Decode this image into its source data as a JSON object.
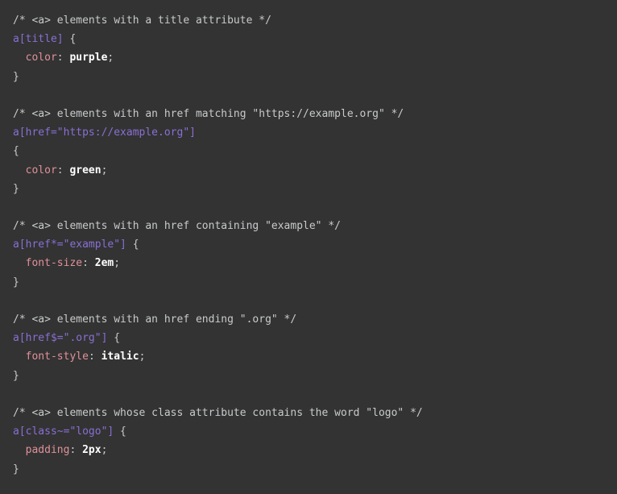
{
  "editor": {
    "background_color": "#333333",
    "font_size_px": 13,
    "language": "css"
  },
  "theme": {
    "comment_color": "#c8cacb",
    "selector_color": "#8a6fd4",
    "property_color": "#e0919a",
    "value_color": "#ffffff",
    "punctuation_color": "#c8cacb"
  },
  "code": {
    "blocks": [
      {
        "comment": "/* <a> elements with a title attribute */",
        "selector": "a[title]",
        "brace_open": " {",
        "brace_on_own_line": false,
        "brace_open_line": "{",
        "property": "color",
        "separator": ": ",
        "value": "purple",
        "terminator": ";",
        "brace_close": "}"
      },
      {
        "comment": "/* <a> elements with an href matching \"https://example.org\" */",
        "selector": "a[href=\"https://example.org\"]",
        "brace_open": "",
        "brace_on_own_line": true,
        "brace_open_line": "{",
        "property": "color",
        "separator": ": ",
        "value": "green",
        "terminator": ";",
        "brace_close": "}"
      },
      {
        "comment": "/* <a> elements with an href containing \"example\" */",
        "selector": "a[href*=\"example\"]",
        "brace_open": " {",
        "brace_on_own_line": false,
        "brace_open_line": "{",
        "property": "font-size",
        "separator": ": ",
        "value": "2em",
        "terminator": ";",
        "brace_close": "}"
      },
      {
        "comment": "/* <a> elements with an href ending \".org\" */",
        "selector": "a[href$=\".org\"]",
        "brace_open": " {",
        "brace_on_own_line": false,
        "brace_open_line": "{",
        "property": "font-style",
        "separator": ": ",
        "value": "italic",
        "terminator": ";",
        "brace_close": "}"
      },
      {
        "comment": "/* <a> elements whose class attribute contains the word \"logo\" */",
        "selector": "a[class~=\"logo\"]",
        "brace_open": " {",
        "brace_on_own_line": false,
        "brace_open_line": "{",
        "property": "padding",
        "separator": ": ",
        "value": "2px",
        "terminator": ";",
        "brace_close": "}"
      }
    ],
    "indent": "  "
  }
}
